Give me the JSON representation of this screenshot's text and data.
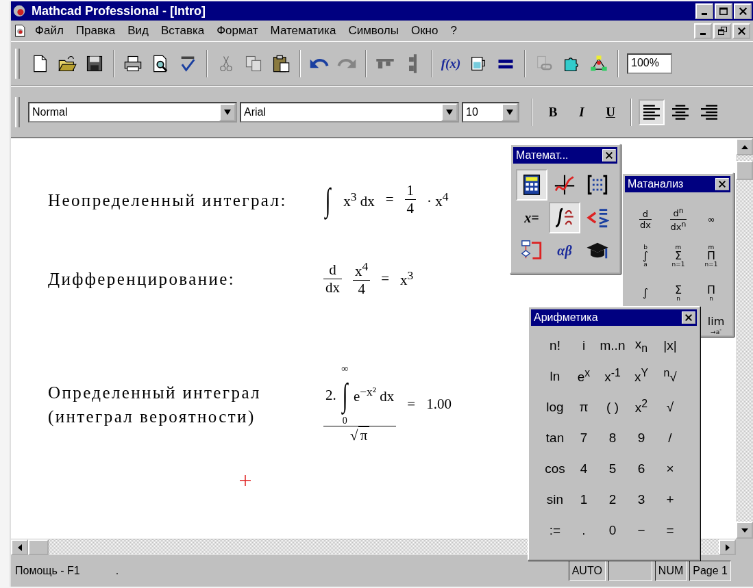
{
  "window": {
    "title": "Mathcad Professional - [Intro]"
  },
  "menu": [
    "Файл",
    "Правка",
    "Вид",
    "Вставка",
    "Формат",
    "Математика",
    "Символы",
    "Окно",
    "?"
  ],
  "toolbar": {
    "buttons": [
      {
        "kind": "new",
        "disabled": false
      },
      {
        "kind": "open",
        "disabled": false
      },
      {
        "kind": "save",
        "disabled": false
      },
      {
        "kind": "separator"
      },
      {
        "kind": "print",
        "disabled": false
      },
      {
        "kind": "preview",
        "disabled": false
      },
      {
        "kind": "spell",
        "disabled": false
      },
      {
        "kind": "separator"
      },
      {
        "kind": "cut",
        "disabled": true
      },
      {
        "kind": "copy",
        "disabled": true
      },
      {
        "kind": "paste",
        "disabled": false
      },
      {
        "kind": "separator"
      },
      {
        "kind": "undo",
        "disabled": false
      },
      {
        "kind": "redo",
        "disabled": true
      },
      {
        "kind": "separator"
      },
      {
        "kind": "align_across",
        "disabled": true
      },
      {
        "kind": "align_down",
        "disabled": true
      },
      {
        "kind": "separator"
      },
      {
        "kind": "function",
        "label": "f(x)",
        "disabled": false
      },
      {
        "kind": "resource",
        "disabled": false
      },
      {
        "kind": "calculate",
        "disabled": false
      },
      {
        "kind": "separator"
      },
      {
        "kind": "hyperlink",
        "disabled": true
      },
      {
        "kind": "component",
        "disabled": false
      },
      {
        "kind": "tree",
        "disabled": false
      },
      {
        "kind": "separator"
      }
    ],
    "zoom": "100%"
  },
  "format_bar": {
    "style": "Normal",
    "font": "Arial",
    "size": "10",
    "text_styles": [
      {
        "kind": "bold",
        "label": "B"
      },
      {
        "kind": "italic",
        "label": "I"
      },
      {
        "kind": "underline",
        "label": "U"
      }
    ],
    "alignment": [
      {
        "kind": "left",
        "selected": true
      },
      {
        "kind": "center",
        "selected": false
      },
      {
        "kind": "right",
        "selected": false
      }
    ]
  },
  "document": {
    "regions": [
      {
        "label": "Неопределенный интеграл:",
        "math": [
          {
            "kind": "op",
            "sign": "∫"
          },
          {
            "kind": "text",
            "s": "x$^{3}$ dx"
          },
          {
            "kind": "text",
            "s": "="
          },
          {
            "kind": "frac",
            "num": "1",
            "den": "4"
          },
          {
            "kind": "text",
            "s": "· x$^{4}$"
          }
        ]
      },
      {
        "label": "Дифференцирование:",
        "math": [
          {
            "kind": "frac",
            "num": "d",
            "den": "dx"
          },
          {
            "kind": "frac",
            "num": "x$^{4}$",
            "den": "4"
          },
          {
            "kind": "text",
            "s": "="
          },
          {
            "kind": "text",
            "s": "x$^{3}$"
          }
        ]
      },
      {
        "label": "Определенный интеграл (интеграл вероятности)",
        "math": [
          {
            "kind": "frac",
            "num": [
              {
                "kind": "text",
                "s": "2."
              },
              {
                "kind": "op",
                "sign": "∫",
                "upper": "∞",
                "lower": "0"
              },
              {
                "kind": "text",
                "s": "e$^{−x²}$ dx"
              }
            ],
            "den": [
              {
                "kind": "sqrt",
                "sign": "√",
                "body": "π"
              }
            ]
          },
          {
            "kind": "text",
            "s": "="
          },
          {
            "kind": "text",
            "s": "1.00"
          }
        ]
      }
    ]
  },
  "palettes": [
    {
      "kind": "math",
      "title": "Математ...",
      "buttons": [
        {
          "kind": "calculator",
          "selected": true
        },
        {
          "kind": "graph",
          "selected": false
        },
        {
          "kind": "matrix",
          "selected": false
        },
        {
          "kind": "label",
          "text": "x=",
          "selected": false
        },
        {
          "kind": "calculus",
          "selected": true
        },
        {
          "kind": "boolean",
          "selected": false
        },
        {
          "kind": "programming",
          "selected": false
        },
        {
          "kind": "label",
          "text": "αβ",
          "selected": false
        },
        {
          "kind": "symbolic",
          "selected": false
        }
      ]
    },
    {
      "kind": "calculus",
      "title": "Матанализ",
      "buttons": [
        {
          "kind": "math",
          "parts": [
            {
              "kind": "frac",
              "num": "d",
              "den": "dx"
            }
          ],
          "selected": false
        },
        {
          "kind": "math",
          "parts": [
            {
              "kind": "frac",
              "num": "d$^{n}$",
              "den": "dx$^{n}$"
            }
          ],
          "selected": false
        },
        {
          "kind": "math",
          "parts": [
            {
              "kind": "text",
              "s": "∞"
            }
          ],
          "selected": false
        },
        {
          "kind": "math",
          "parts": [
            {
              "kind": "op",
              "sign": "∫",
              "upper": "b",
              "lower": "a"
            }
          ],
          "selected": false
        },
        {
          "kind": "math",
          "parts": [
            {
              "kind": "op",
              "sign": "Σ",
              "upper": "m",
              "lower": "n=1"
            }
          ],
          "selected": false
        },
        {
          "kind": "math",
          "parts": [
            {
              "kind": "op",
              "sign": "Π",
              "upper": "m",
              "lower": "n=1"
            }
          ],
          "selected": false
        },
        {
          "kind": "math",
          "parts": [
            {
              "kind": "op",
              "sign": "∫"
            }
          ],
          "selected": false
        },
        {
          "kind": "math",
          "parts": [
            {
              "kind": "op",
              "sign": "Σ",
              "lower": "n"
            }
          ],
          "selected": false
        },
        {
          "kind": "math",
          "parts": [
            {
              "kind": "op",
              "sign": "Π",
              "lower": "n"
            }
          ],
          "selected": false
        },
        {
          "kind": "math",
          "parts": [
            {
              "kind": "op",
              "sign": "lim",
              "lower": "→a$^{-}$"
            }
          ],
          "selected": false
        }
      ]
    },
    {
      "kind": "arithmetic",
      "title": "Арифметика",
      "buttons": [
        {
          "kind": "text",
          "text": "n!",
          "selected": false
        },
        {
          "kind": "text",
          "text": "i",
          "selected": false
        },
        {
          "kind": "text",
          "text": "m..n",
          "selected": false
        },
        {
          "kind": "text",
          "text": "x$_{n}$",
          "selected": false
        },
        {
          "kind": "text",
          "text": "|x|",
          "selected": false
        },
        {
          "kind": "text",
          "text": "ln",
          "selected": false
        },
        {
          "kind": "text",
          "text": "e$^{x}$",
          "selected": false
        },
        {
          "kind": "text",
          "text": "x$^{-1}$",
          "selected": false
        },
        {
          "kind": "text",
          "text": "x$^{Y}$",
          "selected": false
        },
        {
          "kind": "text",
          "text": "$^{n}$√",
          "selected": false
        },
        {
          "kind": "text",
          "text": "log",
          "selected": false
        },
        {
          "kind": "text",
          "text": "π",
          "selected": false
        },
        {
          "kind": "text",
          "text": "( )",
          "selected": false
        },
        {
          "kind": "text",
          "text": "x$^{2}$",
          "selected": false
        },
        {
          "kind": "text",
          "text": "√",
          "selected": false
        },
        {
          "kind": "text",
          "text": "tan",
          "selected": false
        },
        {
          "kind": "text",
          "text": "7",
          "selected": false
        },
        {
          "kind": "text",
          "text": "8",
          "selected": false
        },
        {
          "kind": "text",
          "text": "9",
          "selected": false
        },
        {
          "kind": "text",
          "text": "/",
          "selected": false
        },
        {
          "kind": "text",
          "text": "cos",
          "selected": false
        },
        {
          "kind": "text",
          "text": "4",
          "selected": false
        },
        {
          "kind": "text",
          "text": "5",
          "selected": false
        },
        {
          "kind": "text",
          "text": "6",
          "selected": false
        },
        {
          "kind": "text",
          "text": "×",
          "selected": false
        },
        {
          "kind": "text",
          "text": "sin",
          "selected": false
        },
        {
          "kind": "text",
          "text": "1",
          "selected": false
        },
        {
          "kind": "text",
          "text": "2",
          "selected": false
        },
        {
          "kind": "text",
          "text": "3",
          "selected": false
        },
        {
          "kind": "text",
          "text": "+",
          "selected": false
        },
        {
          "kind": "text",
          "text": ":=",
          "selected": false
        },
        {
          "kind": "text",
          "text": ".",
          "selected": false
        },
        {
          "kind": "text",
          "text": "0",
          "selected": false
        },
        {
          "kind": "text",
          "text": "−",
          "selected": false
        },
        {
          "kind": "text",
          "text": "=",
          "selected": false
        }
      ]
    }
  ],
  "status_bar": {
    "help": "Помощь - F1",
    "mark": ".",
    "panels": [
      {
        "kind": "text",
        "label": "AUTO"
      },
      {
        "kind": "empty"
      },
      {
        "kind": "text",
        "label": "NUM"
      },
      {
        "kind": "text",
        "label": "Page 1"
      }
    ]
  }
}
